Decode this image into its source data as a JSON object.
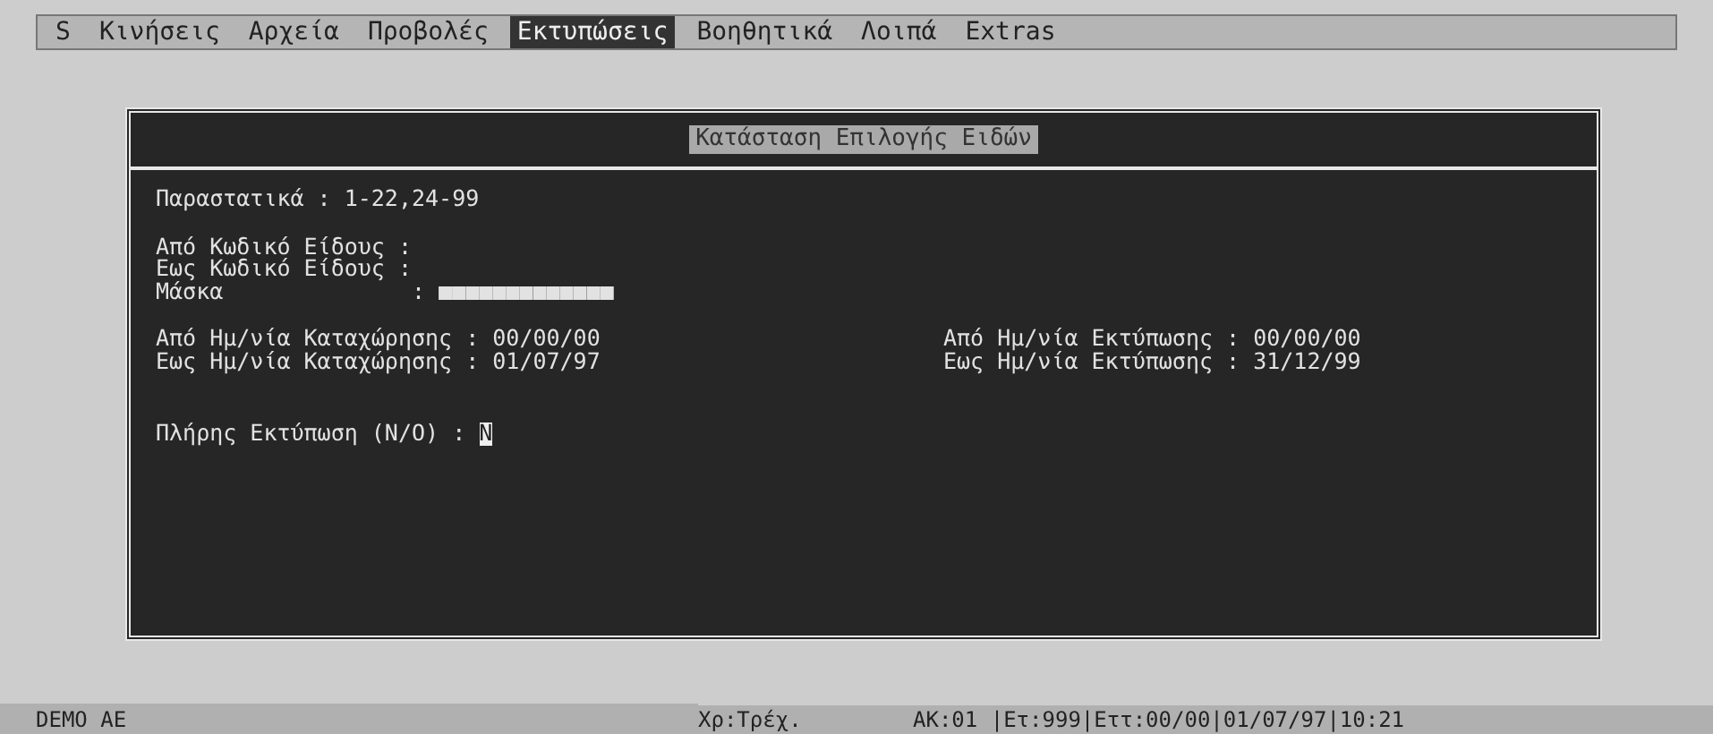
{
  "menu": [
    {
      "label": "S",
      "selected": false
    },
    {
      "label": "Κινήσεις",
      "selected": false
    },
    {
      "label": "Αρχεία",
      "selected": false
    },
    {
      "label": "Προβολές",
      "selected": false
    },
    {
      "label": "Εκτυπώσεις",
      "selected": true
    },
    {
      "label": "Βοηθητικά",
      "selected": false
    },
    {
      "label": "Λοιπά",
      "selected": false
    },
    {
      "label": "Extras",
      "selected": false
    }
  ],
  "dialog": {
    "title": "Κατάσταση Επιλογής Ειδών",
    "rows": [
      {
        "kind": "field",
        "label": "Παραστατικά :",
        "value": "1-22,24-99"
      },
      {
        "kind": "gap"
      },
      {
        "kind": "field",
        "label": "Από Κωδικό Είδους :",
        "value": ""
      },
      {
        "kind": "field",
        "label": "Εως Κωδικό Είδους :",
        "value": ""
      },
      {
        "kind": "field",
        "label": "Μάσκα              :",
        "value": "■■■■■■■■■■■■■"
      },
      {
        "kind": "gap"
      },
      {
        "kind": "pair",
        "label": "Από Ημ/νία Καταχώρησης :",
        "value": "00/00/00",
        "label2": "Από Ημ/νία Εκτύπωσης :",
        "value2": "00/00/00"
      },
      {
        "kind": "pair",
        "label": "Εως Ημ/νία Καταχώρησης :",
        "value": "01/07/97",
        "label2": "Εως Ημ/νία Εκτύπωσης :",
        "value2": "31/12/99"
      },
      {
        "kind": "gap"
      },
      {
        "kind": "gap"
      },
      {
        "kind": "input",
        "label": "Πλήρης Εκτύπωση (Ν/Ο) :",
        "value": "Ν"
      }
    ]
  },
  "status_bar": {
    "left": "DEMO AE",
    "middle": "Χρ:Τρέχ.",
    "right": "ΑΚ:01 |Ετ:999|Εττ:00/00|01/07/97|10:21"
  }
}
